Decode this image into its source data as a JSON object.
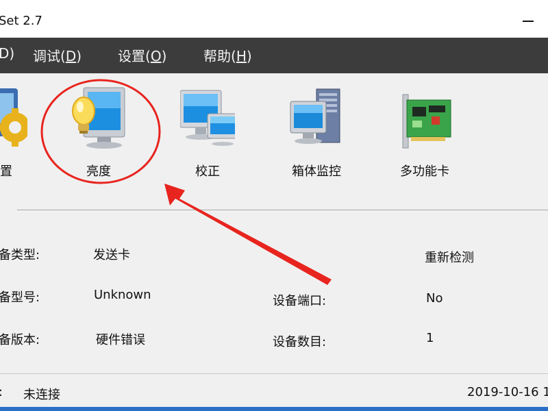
{
  "window": {
    "title": "Set 2.7"
  },
  "menu": {
    "items": [
      {
        "label": "D)",
        "underline": ""
      },
      {
        "label_pre": "调试(",
        "underline": "D",
        "label_post": ")"
      },
      {
        "label_pre": "设置(",
        "underline": "O",
        "label_post": ")"
      },
      {
        "label_pre": "帮助(",
        "underline": "H",
        "label_post": ")"
      }
    ]
  },
  "toolbar": {
    "items": [
      {
        "label": "配置",
        "icon": "gear-icon"
      },
      {
        "label": "亮度",
        "icon": "brightness-bulb-monitor-icon"
      },
      {
        "label": "校正",
        "icon": "calibration-monitor-icon"
      },
      {
        "label": "箱体监控",
        "icon": "cabinet-monitor-icon"
      },
      {
        "label": "多功能卡",
        "icon": "multifunction-card-icon"
      }
    ]
  },
  "device": {
    "type_label": "备类型:",
    "type_value": "发送卡",
    "model_label": "备型号:",
    "model_value": "Unknown",
    "version_label": "备版本:",
    "version_value": "硬件错误",
    "port_label": "设备端口:",
    "port_value": "No",
    "count_label": "设备数目:",
    "count_value": "1",
    "redetect_label": "重新检测"
  },
  "status": {
    "prefix": ":",
    "connection": "未连接",
    "datetime": "2019-10-16 1"
  },
  "colors": {
    "menubar_bg": "#3c3c3c",
    "annotation_red": "#e8241e",
    "accent_blue": "#2b6fc9"
  }
}
